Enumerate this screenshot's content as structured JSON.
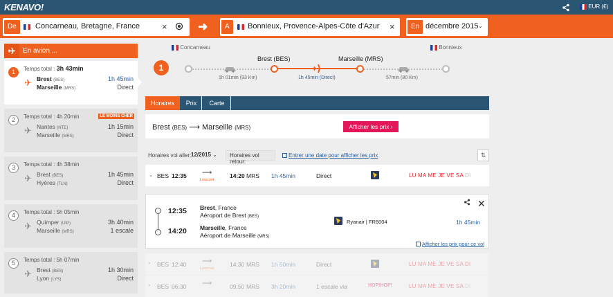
{
  "brand": {
    "logo": "KENAVO!",
    "currency": "EUR (€)"
  },
  "search": {
    "from_tag": "De",
    "from_value": "Concarneau, Bretagne, France",
    "to_tag": "A",
    "to_value": "Bonnieux, Provence-Alpes-Côte d'Azur",
    "when_tag": "En",
    "when_value": "décembre 2015"
  },
  "sidebar": {
    "header": "En avion ...",
    "cards": [
      {
        "num": "1",
        "total": "Temps total :",
        "time": "3h 43min",
        "l1": "Brest",
        "c1": "(BES)",
        "l2": "Marseille",
        "c2": "(MRS)",
        "dur": "1h 45min",
        "type": "Direct",
        "badge": ""
      },
      {
        "num": "2",
        "total": "Temps total : 4h 20min",
        "time": "",
        "l1": "Nantes",
        "c1": "(NTE)",
        "l2": "Marseille",
        "c2": "(MRS)",
        "dur": "1h 15min",
        "type": "Direct",
        "badge": "LE MOINS CHER"
      },
      {
        "num": "3",
        "total": "Temps total : 4h 38min",
        "time": "",
        "l1": "Brest",
        "c1": "(BES)",
        "l2": "Hyères",
        "c2": "(TLN)",
        "dur": "1h 45min",
        "type": "Direct",
        "badge": ""
      },
      {
        "num": "4",
        "total": "Temps total : 5h 05min",
        "time": "",
        "l1": "Quimper",
        "c1": "(UIP)",
        "l2": "Marseille",
        "c2": "(MRS)",
        "dur": "3h 40min",
        "type": "1 escale",
        "badge": ""
      },
      {
        "num": "5",
        "total": "Temps total : 5h 07min",
        "time": "",
        "l1": "Brest",
        "c1": "(BES)",
        "l2": "Lyon",
        "c2": "(LYS)",
        "dur": "1h 30min",
        "type": "Direct",
        "badge": ""
      }
    ]
  },
  "route": {
    "num": "1",
    "origin": "Concarneau",
    "dest": "Bonnieux",
    "hub1": "Brest (BES)",
    "hub2": "Marseille (MRS)",
    "seg1": "1h 01min (93 Km)",
    "seg2": "1h 45min (Direct)",
    "seg3": "57min (80 Km)"
  },
  "tabs": [
    "Horaires",
    "Prix",
    "Carte"
  ],
  "routebox": {
    "from": "Brest",
    "from_code": "(BES)",
    "arrow": "⟶",
    "to": "Marseille",
    "to_code": "(MRS)",
    "button": "Afficher les prix ›"
  },
  "filters": {
    "label1": "Horaires vol aller:",
    "select1": "12/2015",
    "label2": "Horaires vol retour:",
    "link": "Entrer une date pour afficher les prix"
  },
  "flights": [
    {
      "dep": "BES",
      "dep_time": "12:35",
      "lowcost": "Lowcost",
      "arr_time": "14:20",
      "arr": "MRS",
      "dur": "1h 45min",
      "type": "Direct",
      "days_on": "LU MA ME JE VE SA",
      "days_off": "DI"
    },
    {
      "dep": "BES",
      "dep_time": "12:40",
      "lowcost": "Lowcost",
      "arr_time": "14:30",
      "arr": "MRS",
      "dur": "1h 50min",
      "type": "Direct",
      "days_on": "LU MA ME JE VE SA DI",
      "days_off": ""
    },
    {
      "dep": "BES",
      "dep_time": "06:30",
      "lowcost": "",
      "arr_time": "09:50",
      "arr": "MRS",
      "dur": "3h 20min",
      "type": "1 escale via",
      "days_on": "LU MA ME JE VE SA",
      "days_off": "DI",
      "hop": "HOP!HOP!"
    }
  ],
  "detail": {
    "dep_time": "12:35",
    "dep_city": "Brest",
    "dep_country": ", France",
    "dep_airport": "Aéroport de Brest",
    "dep_code": "(BES)",
    "arr_time": "14:20",
    "arr_city": "Marseille",
    "arr_country": ", France",
    "arr_airport": "Aéroport de Marseille",
    "arr_code": "(MRS)",
    "airline": "Ryanair | FR6004",
    "dur": "1h 45min",
    "prices_link": "Afficher les prix pour ce vol"
  },
  "icons": [
    "share-icon",
    "flag-fr-icon",
    "close-icon",
    "target-icon",
    "arrow-right-icon",
    "plane-icon",
    "car-icon",
    "sort-icon",
    "calendar-icon",
    "chevron-down-icon",
    "ryanair-logo-icon"
  ],
  "colors": {
    "brand_orange": "#f0601f",
    "nav_blue": "#2a5573",
    "price_pink": "#e5175b",
    "link_blue": "#2a5f9e",
    "days_red": "#e0242c"
  }
}
